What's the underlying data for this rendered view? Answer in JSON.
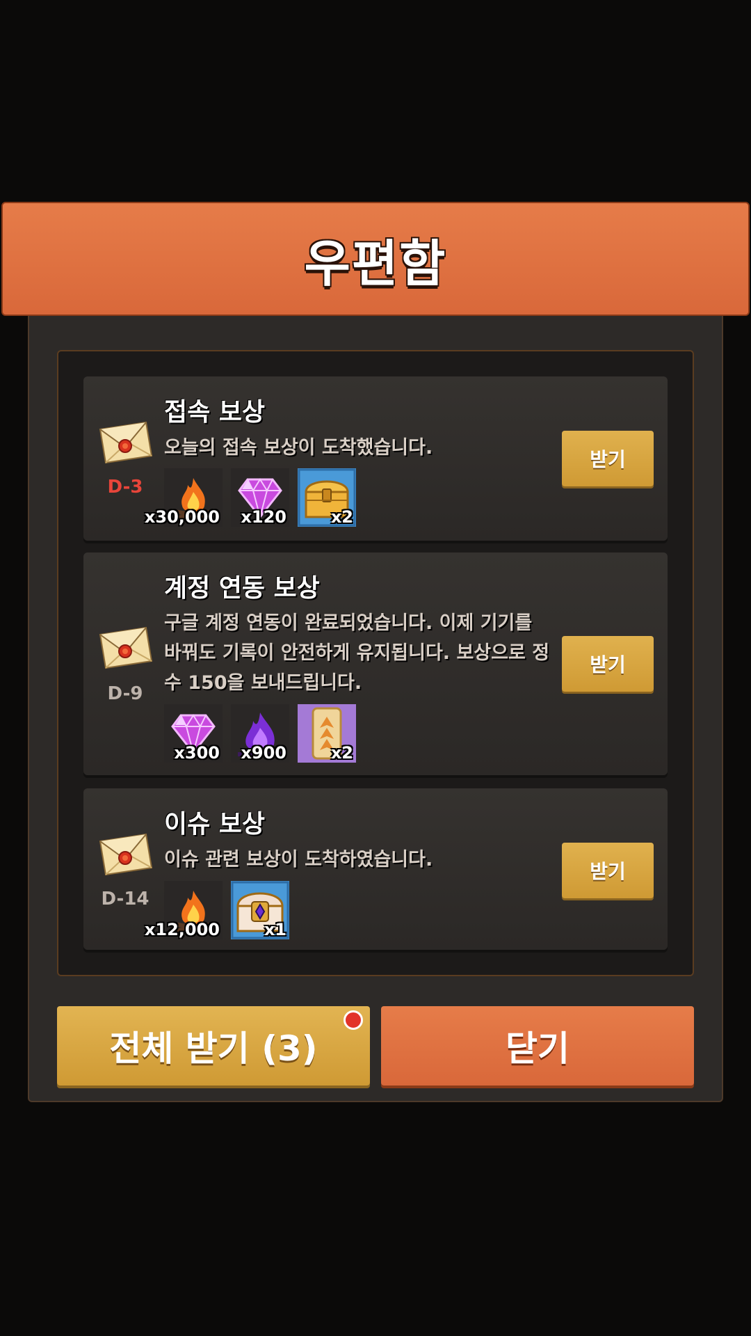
{
  "header": {
    "title": "우편함"
  },
  "mails": [
    {
      "dday": "D-3",
      "dday_color": "#e8453a",
      "title": "접속 보상",
      "description": "오늘의 접속 보상이 도착했습니다.",
      "rewards": [
        {
          "icon": "fire-icon",
          "count": "x30,000"
        },
        {
          "icon": "purple-gem-icon",
          "count": "x120"
        },
        {
          "icon": "gold-chest-icon",
          "count": "x2"
        }
      ],
      "claim_label": "받기"
    },
    {
      "dday": "D-9",
      "dday_color": "#bdb3ab",
      "title": "계정 연동 보상",
      "description": "구글 계정 연동이 완료되었습니다. 이제 기기를 바꿔도 기록이 안전하게 유지됩니다. 보상으로 정수 150을 보내드립니다.",
      "rewards": [
        {
          "icon": "purple-gem-icon",
          "count": "x300"
        },
        {
          "icon": "purple-flame-icon",
          "count": "x900"
        },
        {
          "icon": "card-icon",
          "count": "x2"
        }
      ],
      "claim_label": "받기"
    },
    {
      "dday": "D-14",
      "dday_color": "#bdb3ab",
      "title": "이슈 보상",
      "description": "이슈 관련 보상이 도착하였습니다.",
      "rewards": [
        {
          "icon": "fire-icon",
          "count": "x12,000"
        },
        {
          "icon": "jeweled-chest-icon",
          "count": "x1"
        }
      ],
      "claim_label": "받기"
    }
  ],
  "footer": {
    "claim_all_label": "전체 받기 (3)",
    "close_label": "닫기"
  },
  "colors": {
    "accent_orange": "#e07543",
    "gold": "#d9a843",
    "alert_red": "#e2332a"
  }
}
